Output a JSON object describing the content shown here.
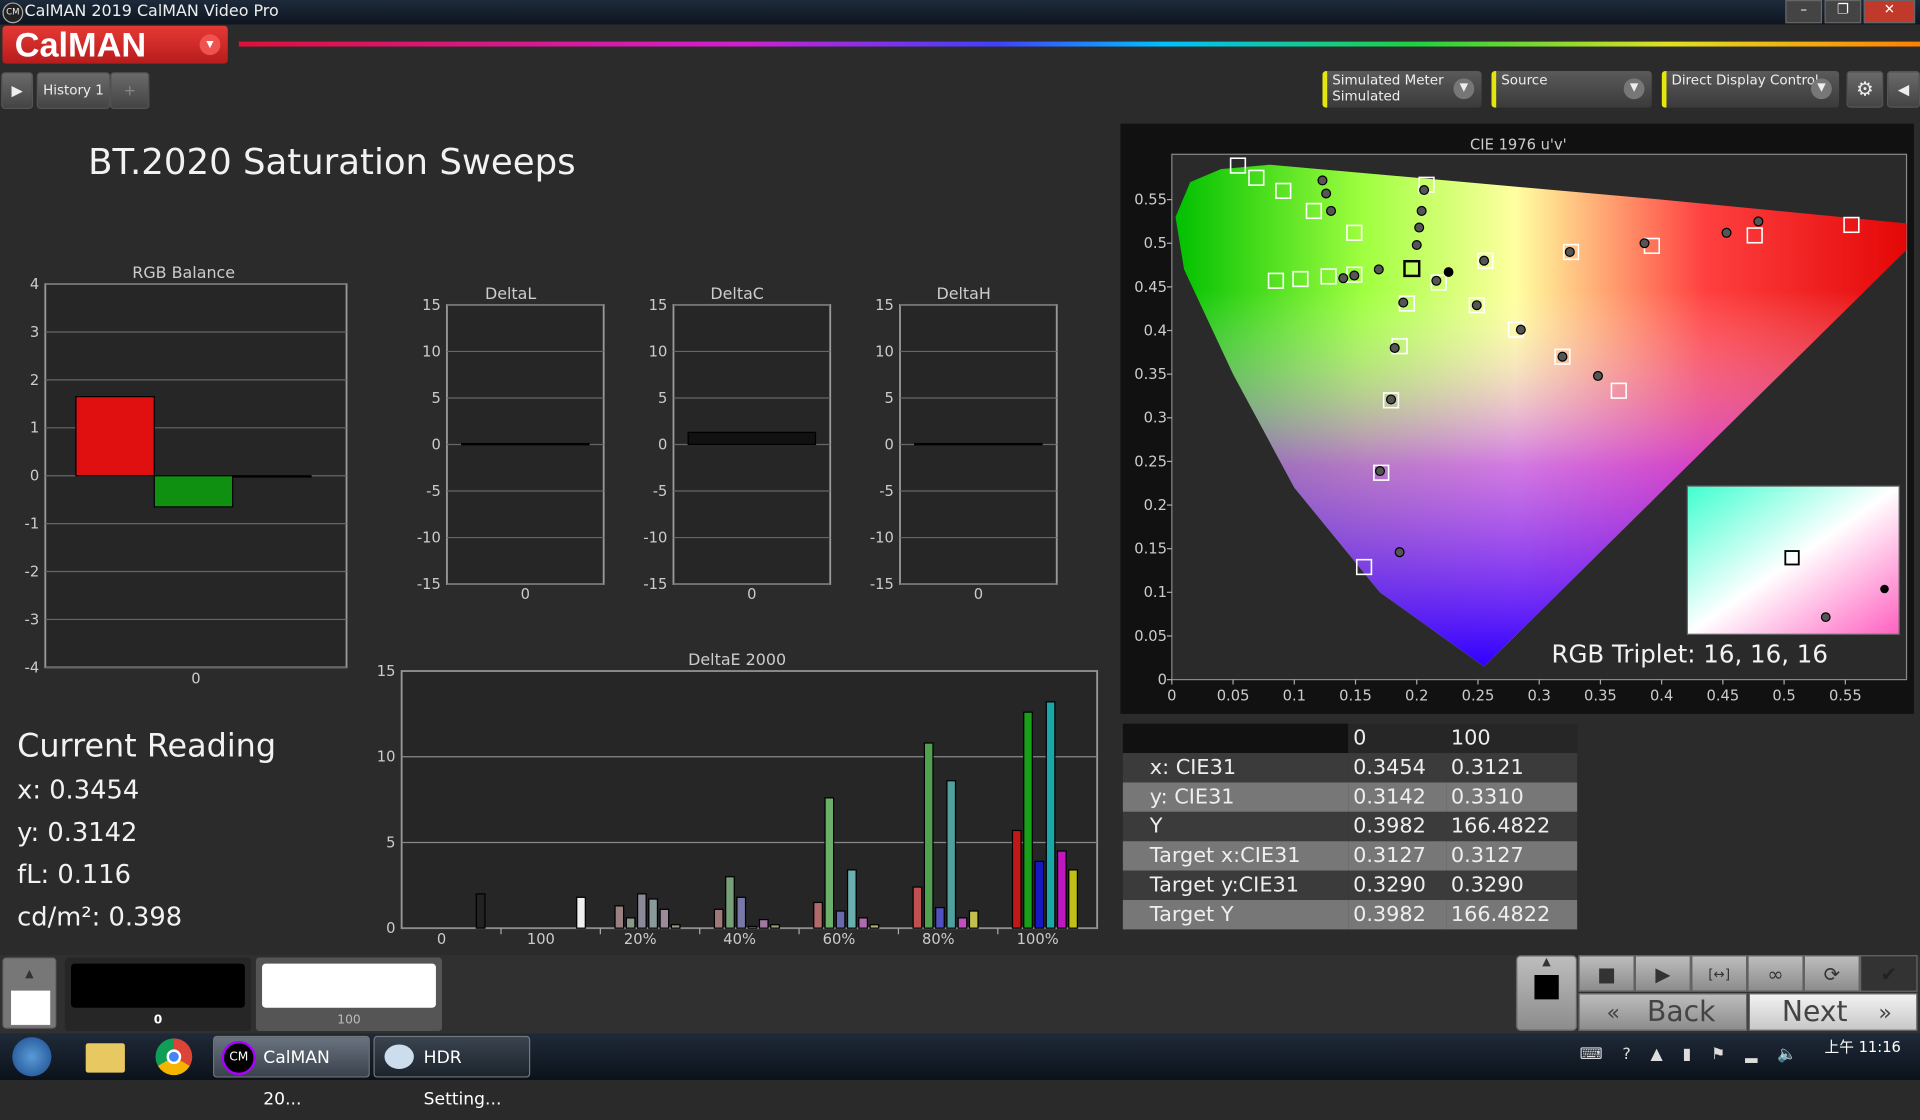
{
  "window": {
    "title": "CalMAN 2019 CalMAN Video Pro",
    "controls": [
      "–",
      "❐",
      "✕"
    ]
  },
  "app": {
    "logo": "CalMAN",
    "accent": "#e53935"
  },
  "tabs": {
    "play": "▶",
    "history": "History 1",
    "add": "+"
  },
  "toolbar": {
    "meter_label": "Simulated Meter",
    "meter_value": "Simulated",
    "source_label": "Source",
    "display_label": "Direct Display Control",
    "settings": "⚙",
    "collapse": "◀"
  },
  "page": {
    "title": "BT.2020 Saturation Sweeps"
  },
  "rgb_balance": {
    "title": "RGB Balance",
    "yticks": [
      "4",
      "3",
      "2",
      "1",
      "0",
      "-1",
      "-2",
      "-3",
      "-4"
    ],
    "category": "0",
    "values": {
      "red": 1.65,
      "green": -0.65,
      "blue": 0.0
    }
  },
  "delta_charts": [
    {
      "title": "DeltaL",
      "category": "0",
      "value": 0.1,
      "color": "#111111"
    },
    {
      "title": "DeltaC",
      "category": "0",
      "value": 1.3,
      "color": "#111111"
    },
    {
      "title": "DeltaH",
      "category": "0",
      "value": 0.1,
      "color": "#111111"
    }
  ],
  "delta_yticks": [
    "15",
    "10",
    "5",
    "0",
    "-5",
    "-10",
    "-15"
  ],
  "chart_data": {
    "type": "bar",
    "title": "DeltaE 2000",
    "ylim": [
      0,
      15
    ],
    "yticks": [
      "15",
      "10",
      "5",
      "0"
    ],
    "categories": [
      "0",
      "100",
      "20%",
      "40%",
      "60%",
      "80%",
      "100%"
    ],
    "groups": [
      {
        "label": "0",
        "values": [
          2.0
        ],
        "colors": [
          "#222222"
        ]
      },
      {
        "label": "100",
        "values": [
          1.8
        ],
        "colors": [
          "#f0f0f0"
        ]
      },
      {
        "label": "20%",
        "values": [
          1.3,
          0.6,
          2.0,
          1.7,
          1.1,
          0.2
        ],
        "colors": [
          "#9a8080",
          "#8a9a8a",
          "#8a8a9a",
          "#8a9a9a",
          "#9a8a9a",
          "#9a9a8a"
        ]
      },
      {
        "label": "40%",
        "values": [
          1.1,
          3.0,
          1.8,
          0.1,
          0.5,
          0.2
        ],
        "colors": [
          "#a07878",
          "#78a078",
          "#7878a8",
          "#78a0a0",
          "#a078a0",
          "#a0a078"
        ]
      },
      {
        "label": "60%",
        "values": [
          1.5,
          7.6,
          1.0,
          3.4,
          0.6,
          0.2
        ],
        "colors": [
          "#b06a6a",
          "#6ab06a",
          "#6a6ab0",
          "#6ab0b0",
          "#b06ab0",
          "#b0b06a"
        ]
      },
      {
        "label": "80%",
        "values": [
          2.4,
          10.8,
          1.2,
          8.6,
          0.6,
          1.0
        ],
        "colors": [
          "#c05050",
          "#50a050",
          "#5050c0",
          "#50a0a0",
          "#c050c0",
          "#c0c050"
        ]
      },
      {
        "label": "100%",
        "values": [
          5.7,
          12.6,
          3.9,
          13.2,
          4.5,
          3.4
        ],
        "colors": [
          "#c01818",
          "#18a018",
          "#1818c0",
          "#18a8a8",
          "#c018c0",
          "#c0c018"
        ]
      }
    ]
  },
  "cie": {
    "title": "CIE 1976 u'v'",
    "xticks": [
      "0",
      "0.05",
      "0.1",
      "0.15",
      "0.2",
      "0.25",
      "0.3",
      "0.35",
      "0.4",
      "0.45",
      "0.5",
      "0.55"
    ],
    "yticks": [
      "0",
      "0.05",
      "0.1",
      "0.15",
      "0.2",
      "0.25",
      "0.3",
      "0.35",
      "0.4",
      "0.45",
      "0.5",
      "0.55"
    ],
    "targets": [
      [
        0.054,
        0.589
      ],
      [
        0.069,
        0.575
      ],
      [
        0.091,
        0.56
      ],
      [
        0.116,
        0.537
      ],
      [
        0.149,
        0.512
      ],
      [
        0.208,
        0.567
      ],
      [
        0.218,
        0.455
      ],
      [
        0.256,
        0.48
      ],
      [
        0.326,
        0.49
      ],
      [
        0.392,
        0.497
      ],
      [
        0.476,
        0.509
      ],
      [
        0.555,
        0.521
      ],
      [
        0.085,
        0.457
      ],
      [
        0.105,
        0.459
      ],
      [
        0.128,
        0.462
      ],
      [
        0.149,
        0.464
      ],
      [
        0.192,
        0.431
      ],
      [
        0.186,
        0.382
      ],
      [
        0.179,
        0.32
      ],
      [
        0.171,
        0.237
      ],
      [
        0.157,
        0.129
      ],
      [
        0.249,
        0.429
      ],
      [
        0.281,
        0.401
      ],
      [
        0.319,
        0.37
      ],
      [
        0.365,
        0.331
      ]
    ],
    "current_target": [
      0.196,
      0.471
    ],
    "measured": [
      [
        0.123,
        0.572
      ],
      [
        0.126,
        0.557
      ],
      [
        0.13,
        0.537
      ],
      [
        0.206,
        0.561
      ],
      [
        0.204,
        0.537
      ],
      [
        0.202,
        0.518
      ],
      [
        0.2,
        0.498
      ],
      [
        0.14,
        0.46
      ],
      [
        0.149,
        0.463
      ],
      [
        0.169,
        0.47
      ],
      [
        0.189,
        0.432
      ],
      [
        0.182,
        0.38
      ],
      [
        0.179,
        0.321
      ],
      [
        0.17,
        0.239
      ],
      [
        0.186,
        0.146
      ],
      [
        0.216,
        0.457
      ],
      [
        0.255,
        0.48
      ],
      [
        0.325,
        0.49
      ],
      [
        0.386,
        0.5
      ],
      [
        0.453,
        0.512
      ],
      [
        0.479,
        0.525
      ],
      [
        0.249,
        0.429
      ],
      [
        0.285,
        0.401
      ],
      [
        0.319,
        0.37
      ],
      [
        0.348,
        0.348
      ]
    ],
    "current_measured": [
      0.226,
      0.467
    ],
    "rgb_triplet": "RGB Triplet: 16, 16, 16"
  },
  "reading": {
    "title": "Current Reading",
    "x": "x: 0.3454",
    "y": "y: 0.3142",
    "fl": "fL: 0.116",
    "cdm2": "cd/m²: 0.398"
  },
  "table": {
    "headers": [
      "",
      "0",
      "100"
    ],
    "rows": [
      [
        "x: CIE31",
        "0.3454",
        "0.3121"
      ],
      [
        "y: CIE31",
        "0.3142",
        "0.3310"
      ],
      [
        "Y",
        "0.3982",
        "166.4822"
      ],
      [
        "Target x:CIE31",
        "0.3127",
        "0.3127"
      ],
      [
        "Target y:CIE31",
        "0.3290",
        "0.3290"
      ],
      [
        "Target Y",
        "0.3982",
        "166.4822"
      ]
    ]
  },
  "patches": [
    {
      "label": "0",
      "color": "#000000"
    },
    {
      "label": "100",
      "color": "#ffffff"
    }
  ],
  "controls": {
    "back": "Back",
    "next": "Next",
    "back_icon": "«",
    "next_icon": "»",
    "stop": "■",
    "play": "▶",
    "fit": "[↔]",
    "loop": "∞",
    "refresh": "⟳",
    "check": "✔",
    "up": "▲"
  },
  "taskbar": {
    "apps": [
      "CalMAN 20...",
      "HDR Setting..."
    ],
    "clock": "上午 11:16",
    "cm": "CM"
  }
}
